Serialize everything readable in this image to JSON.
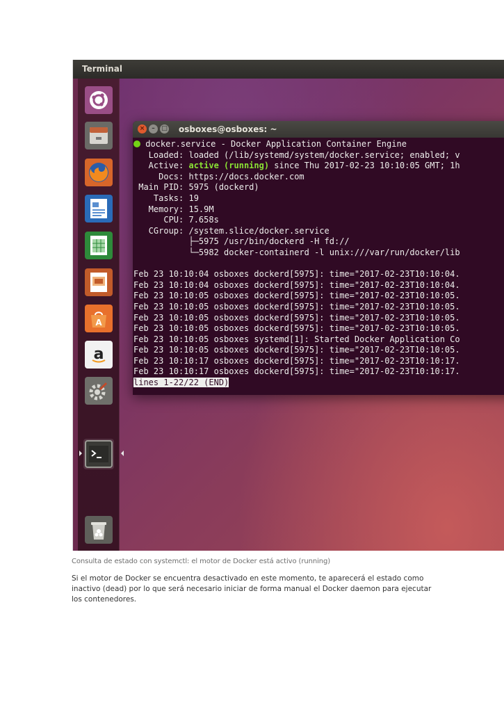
{
  "topbar": {
    "title": "Terminal"
  },
  "launcher": {
    "items": [
      {
        "name": "Dash",
        "icon": "ubuntu-dash-icon"
      },
      {
        "name": "Files",
        "icon": "files-icon"
      },
      {
        "name": "Firefox",
        "icon": "firefox-icon"
      },
      {
        "name": "LibreOffice Writer",
        "icon": "writer-icon"
      },
      {
        "name": "LibreOffice Calc",
        "icon": "calc-icon"
      },
      {
        "name": "LibreOffice Impress",
        "icon": "impress-icon"
      },
      {
        "name": "Ubuntu Software",
        "icon": "software-center-icon"
      },
      {
        "name": "Amazon",
        "icon": "amazon-icon"
      },
      {
        "name": "System Settings",
        "icon": "settings-icon"
      },
      {
        "name": "Terminal",
        "icon": "terminal-icon"
      },
      {
        "name": "Trash",
        "icon": "trash-icon"
      }
    ]
  },
  "terminal": {
    "title": "osboxes@osboxes: ~",
    "lines": {
      "l1": "docker.service - Docker Application Container Engine",
      "l2": "   Loaded: loaded (/lib/systemd/system/docker.service; enabled; v",
      "l3_pre": "   Active: ",
      "l3_active": "active (running)",
      "l3_post": " since Thu 2017-02-23 10:10:05 GMT; 1h",
      "l4": "     Docs: https://docs.docker.com",
      "l5": " Main PID: 5975 (dockerd)",
      "l6": "    Tasks: 19",
      "l7": "   Memory: 15.9M",
      "l8": "      CPU: 7.658s",
      "l9": "   CGroup: /system.slice/docker.service",
      "l10": "           ├─5975 /usr/bin/dockerd -H fd://",
      "l11": "           └─5982 docker-containerd -l unix:///var/run/docker/lib",
      "l12": "",
      "l13": "Feb 23 10:10:04 osboxes dockerd[5975]: time=\"2017-02-23T10:10:04.",
      "l14": "Feb 23 10:10:04 osboxes dockerd[5975]: time=\"2017-02-23T10:10:04.",
      "l15": "Feb 23 10:10:05 osboxes dockerd[5975]: time=\"2017-02-23T10:10:05.",
      "l16": "Feb 23 10:10:05 osboxes dockerd[5975]: time=\"2017-02-23T10:10:05.",
      "l17": "Feb 23 10:10:05 osboxes dockerd[5975]: time=\"2017-02-23T10:10:05.",
      "l18": "Feb 23 10:10:05 osboxes dockerd[5975]: time=\"2017-02-23T10:10:05.",
      "l19": "Feb 23 10:10:05 osboxes systemd[1]: Started Docker Application Co",
      "l20": "Feb 23 10:10:05 osboxes dockerd[5975]: time=\"2017-02-23T10:10:05.",
      "l21": "Feb 23 10:10:17 osboxes dockerd[5975]: time=\"2017-02-23T10:10:17.",
      "l22": "Feb 23 10:10:17 osboxes dockerd[5975]: time=\"2017-02-23T10:10:17.",
      "status": "lines 1-22/22 (END)"
    },
    "colors": {
      "background": "#300a24",
      "active": "#8ae234",
      "dot": "#73d216"
    }
  },
  "caption": "Consulta de estado con systemctl: el motor de Docker está activo (running)",
  "paragraph": "Si el motor de Docker se encuentra desactivado en este momento, te aparecerá el estado como inactivo (dead) por lo que será necesario iniciar de forma manual el Docker daemon para ejecutar los contenedores."
}
